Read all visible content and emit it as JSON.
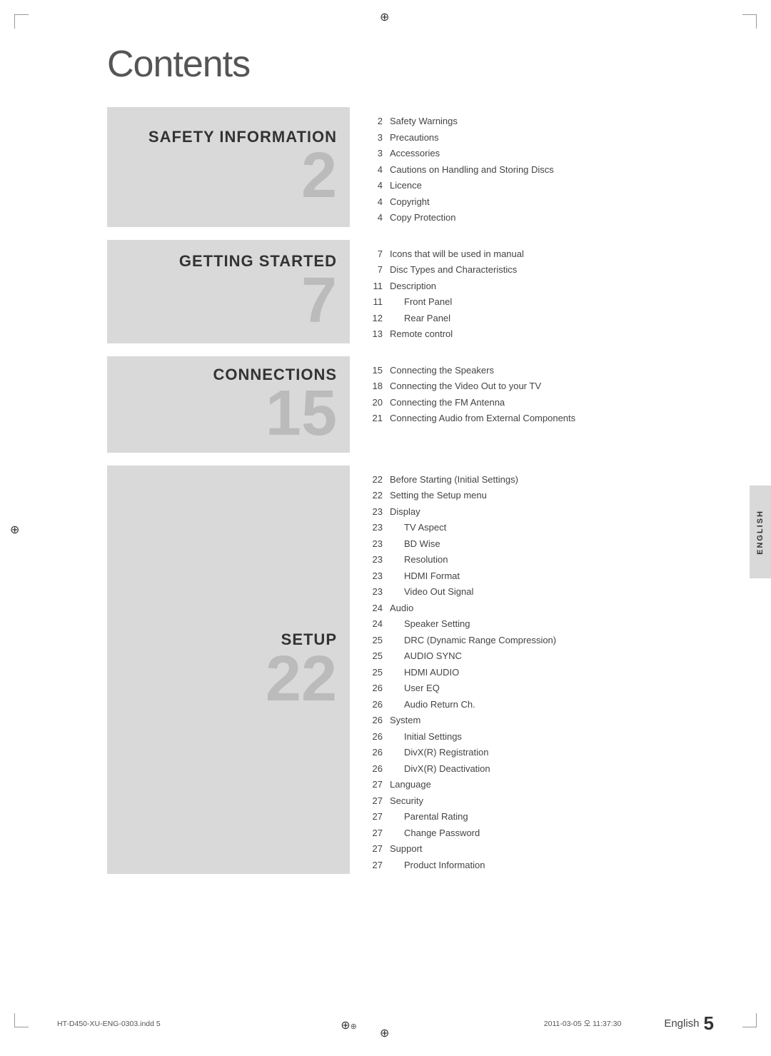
{
  "page": {
    "title": "Contents",
    "sections": [
      {
        "id": "safety-information",
        "title": "SAFETY INFORMATION",
        "number": "2",
        "entries": [
          {
            "page": "2",
            "text": "Safety Warnings",
            "indented": false
          },
          {
            "page": "3",
            "text": "Precautions",
            "indented": false
          },
          {
            "page": "3",
            "text": "Accessories",
            "indented": false
          },
          {
            "page": "4",
            "text": "Cautions on Handling and Storing Discs",
            "indented": false
          },
          {
            "page": "4",
            "text": "Licence",
            "indented": false
          },
          {
            "page": "4",
            "text": "Copyright",
            "indented": false
          },
          {
            "page": "4",
            "text": "Copy Protection",
            "indented": false
          }
        ]
      },
      {
        "id": "getting-started",
        "title": "GETTING STARTED",
        "number": "7",
        "entries": [
          {
            "page": "7",
            "text": "Icons that will be used in manual",
            "indented": false
          },
          {
            "page": "7",
            "text": "Disc Types and Characteristics",
            "indented": false
          },
          {
            "page": "11",
            "text": "Description",
            "indented": false
          },
          {
            "page": "11",
            "text": "Front Panel",
            "indented": true
          },
          {
            "page": "12",
            "text": "Rear Panel",
            "indented": true
          },
          {
            "page": "13",
            "text": "Remote control",
            "indented": false
          }
        ]
      },
      {
        "id": "connections",
        "title": "CONNECTIONS",
        "number": "15",
        "entries": [
          {
            "page": "15",
            "text": "Connecting the Speakers",
            "indented": false
          },
          {
            "page": "18",
            "text": "Connecting the Video Out to your TV",
            "indented": false
          },
          {
            "page": "20",
            "text": "Connecting the FM Antenna",
            "indented": false
          },
          {
            "page": "21",
            "text": "Connecting Audio from External Components",
            "indented": false
          }
        ]
      },
      {
        "id": "setup",
        "title": "SETUP",
        "number": "22",
        "entries": [
          {
            "page": "22",
            "text": "Before Starting (Initial Settings)",
            "indented": false
          },
          {
            "page": "22",
            "text": "Setting the Setup menu",
            "indented": false
          },
          {
            "page": "23",
            "text": "Display",
            "indented": false
          },
          {
            "page": "23",
            "text": "TV Aspect",
            "indented": true
          },
          {
            "page": "23",
            "text": "BD Wise",
            "indented": true
          },
          {
            "page": "23",
            "text": "Resolution",
            "indented": true
          },
          {
            "page": "23",
            "text": "HDMI Format",
            "indented": true
          },
          {
            "page": "23",
            "text": "Video Out Signal",
            "indented": true
          },
          {
            "page": "24",
            "text": "Audio",
            "indented": false
          },
          {
            "page": "24",
            "text": "Speaker Setting",
            "indented": true
          },
          {
            "page": "25",
            "text": "DRC (Dynamic Range Compression)",
            "indented": true
          },
          {
            "page": "25",
            "text": "AUDIO SYNC",
            "indented": true
          },
          {
            "page": "25",
            "text": "HDMI AUDIO",
            "indented": true
          },
          {
            "page": "26",
            "text": "User EQ",
            "indented": true
          },
          {
            "page": "26",
            "text": "Audio Return Ch.",
            "indented": true
          },
          {
            "page": "26",
            "text": "System",
            "indented": false
          },
          {
            "page": "26",
            "text": "Initial Settings",
            "indented": true
          },
          {
            "page": "26",
            "text": "DivX(R) Registration",
            "indented": true
          },
          {
            "page": "26",
            "text": "DivX(R) Deactivation",
            "indented": true
          },
          {
            "page": "27",
            "text": "Language",
            "indented": false
          },
          {
            "page": "27",
            "text": "Security",
            "indented": false
          },
          {
            "page": "27",
            "text": "Parental Rating",
            "indented": true
          },
          {
            "page": "27",
            "text": "Change Password",
            "indented": true
          },
          {
            "page": "27",
            "text": "Support",
            "indented": false
          },
          {
            "page": "27",
            "text": "Product Information",
            "indented": true
          }
        ]
      }
    ],
    "sidebar": {
      "text": "ENGLISH"
    },
    "footer": {
      "left": "HT-D450-XU-ENG-0303.indd  5",
      "right": "2011-03-05  오 11:37:30",
      "english_label": "English",
      "page_number": "5"
    }
  }
}
